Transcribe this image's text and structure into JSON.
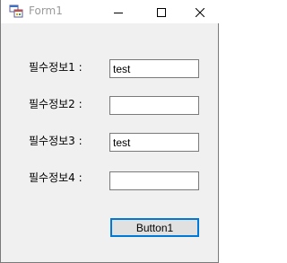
{
  "window": {
    "title": "Form1",
    "icons": {
      "app": "winforms-app-icon",
      "minimize": "minimize-icon",
      "maximize": "maximize-icon",
      "close": "close-icon"
    }
  },
  "form": {
    "fields": [
      {
        "label": "필수정보1 :",
        "value": "test"
      },
      {
        "label": "필수정보2 :",
        "value": ""
      },
      {
        "label": "필수정보3 :",
        "value": "test"
      },
      {
        "label": "필수정보4 :",
        "value": ""
      }
    ],
    "button_label": "Button1"
  },
  "colors": {
    "client_background": "#f0f0f0",
    "button_focus_border": "#0078d7",
    "title_text": "#9b9b9b"
  }
}
